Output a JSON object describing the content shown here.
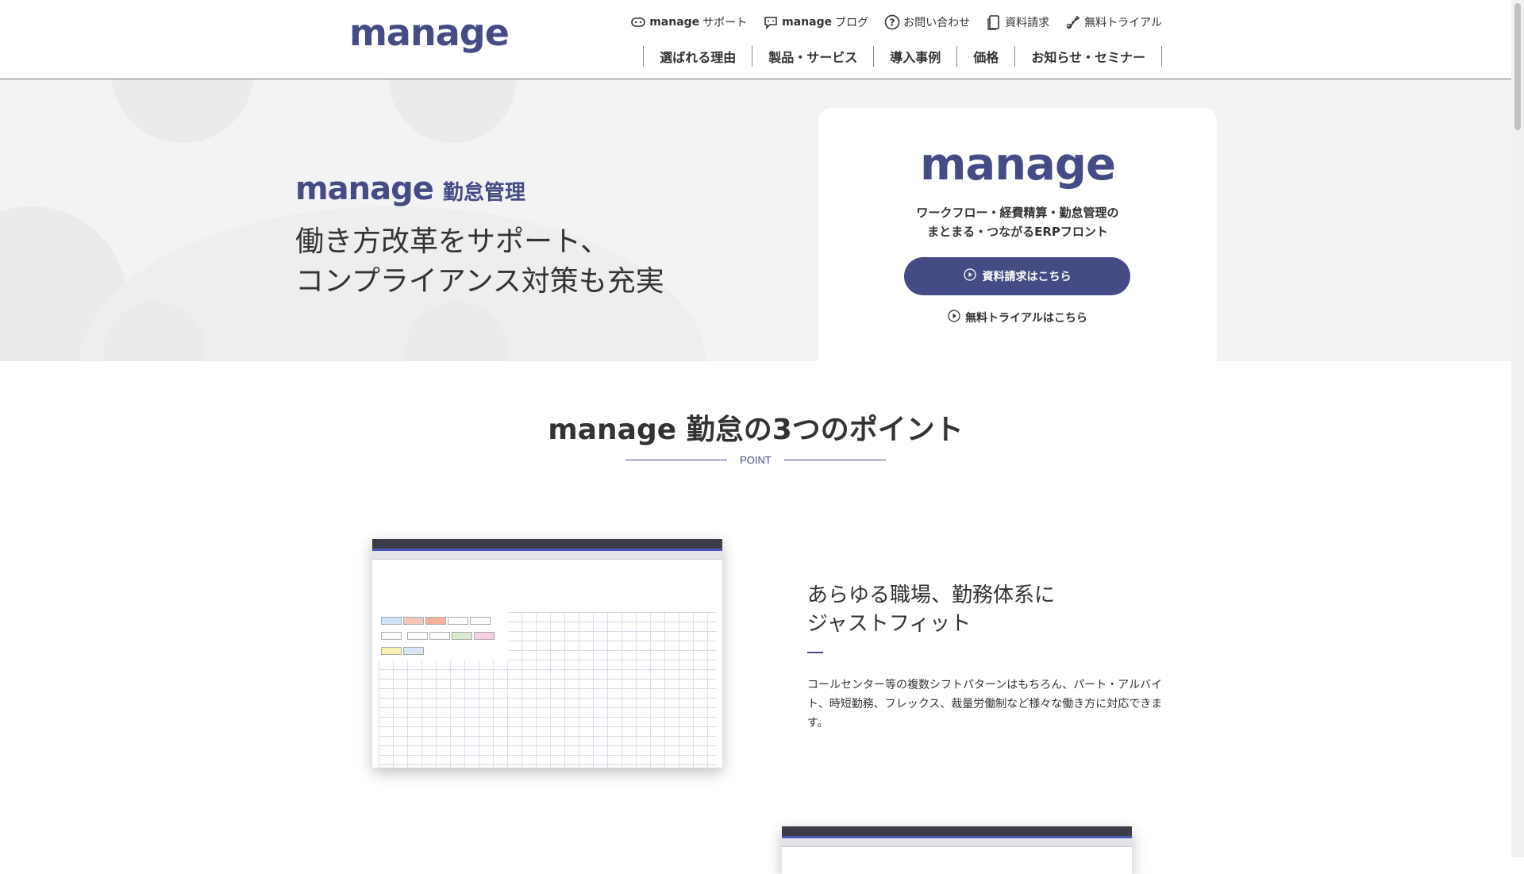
{
  "header": {
    "logo": "manage",
    "util_nav": [
      {
        "bold": "manage",
        "rest": "サポート",
        "icon": "support-icon"
      },
      {
        "bold": "manage",
        "rest": "ブログ",
        "icon": "blog-icon"
      },
      {
        "bold": "",
        "rest": "お問い合わせ",
        "icon": "question-icon"
      },
      {
        "bold": "",
        "rest": "資料請求",
        "icon": "document-icon"
      },
      {
        "bold": "",
        "rest": "無料トライアル",
        "icon": "trial-icon"
      }
    ],
    "main_nav": [
      "選ばれる理由",
      "製品・サービス",
      "導入事例",
      "価格",
      "お知らせ・セミナー"
    ]
  },
  "hero": {
    "brand_logo": "manage",
    "brand_sub": "勤怠管理",
    "catch_line1": "働き方改革をサポート、",
    "catch_line2": "コンプライアンス対策も充実",
    "card": {
      "logo": "manage",
      "desc_line1": "ワークフロー・経費精算・勤怠管理の",
      "desc_line2": "まとまる・つながるERPフロント",
      "button_label": "資料請求はこちら",
      "link_label": "無料トライアルはこちら"
    }
  },
  "points": {
    "title": "manage 勤怠の3つのポイント",
    "subtitle": "POINT",
    "items": [
      {
        "title_line1": "あらゆる職場、勤務体系に",
        "title_line2": "ジャストフィット",
        "description": "コールセンター等の複数シフトパターンはもちろん、パート・アルバイト、時短勤務、フレックス、裁量労働制など様々な働き方に対応できます。"
      }
    ]
  },
  "colors": {
    "brand": "#454b85",
    "hero_bg": "#f3f3f3"
  }
}
